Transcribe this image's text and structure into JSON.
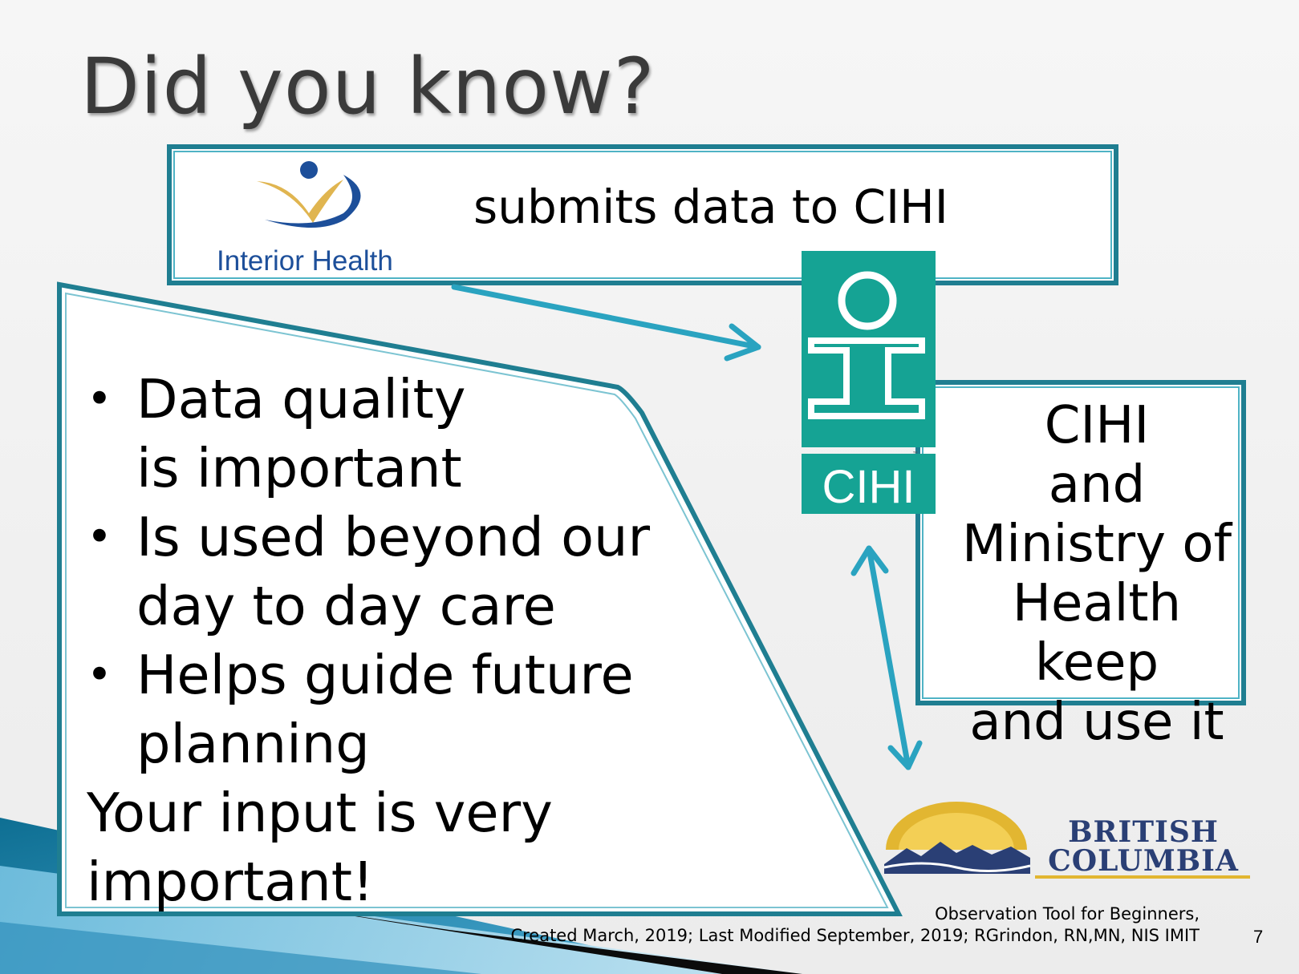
{
  "slide": {
    "title": "Did you know?",
    "top_box": {
      "logo_name": "Interior Health",
      "text": "submits data to CIHI"
    },
    "cihi_logo": {
      "text": "CIHI",
      "trademark": "™"
    },
    "right_box": {
      "lines": [
        "CIHI",
        "and",
        "Ministry of",
        "Health keep",
        "and use it"
      ]
    },
    "bullets": [
      {
        "marker": "•",
        "line1": "Data quality",
        "line2": "is important"
      },
      {
        "marker": "•",
        "line1": "Is used beyond our",
        "line2": "day to day care"
      },
      {
        "marker": "•",
        "line1": "Helps guide future",
        "line2": "planning"
      }
    ],
    "emphasis": {
      "line1": "Your input is very",
      "line2": "important!"
    },
    "bc_logo": {
      "line1": "BRITISH",
      "line2": "COLUMBIA"
    },
    "footer": {
      "line1": "Observation Tool for Beginners,",
      "line2": "Created March, 2019; Last  Modified September, 2019;  RGrindon, RN,MN, NIS IMIT"
    },
    "page_number": "7",
    "colors": {
      "border": "#1f7e91",
      "arrow": "#2aa3c0",
      "cihi_teal": "#15a394",
      "ih_blue": "#1d4f9a",
      "ih_gold": "#e0b550",
      "bc_navy": "#2a3f75",
      "bc_gold": "#e2b631"
    }
  }
}
